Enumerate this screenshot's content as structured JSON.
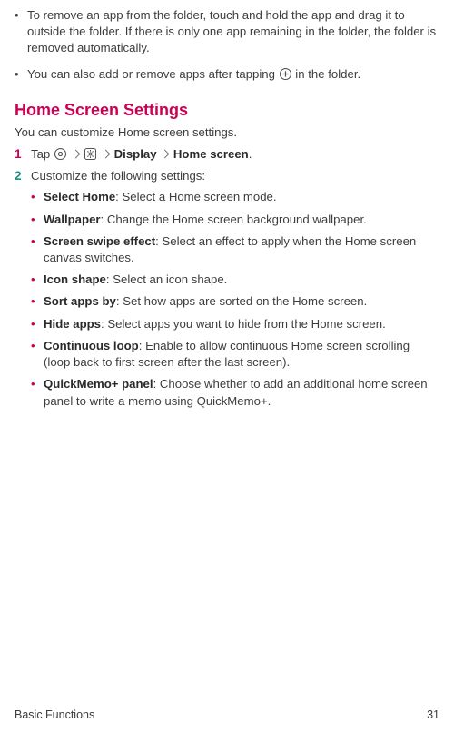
{
  "top_bullets": [
    "To remove an app from the folder, touch and hold the app and drag it to outside the folder. If there is only one app remaining in the folder, the folder is removed automatically.",
    {
      "prefix": "You can also add or remove apps after tapping ",
      "suffix": " in the folder."
    }
  ],
  "icons": {
    "plus_circle": "plus-circle-icon",
    "home_circle": "home-circle-icon",
    "settings_square": "settings-square-icon"
  },
  "section": {
    "title": "Home Screen Settings",
    "subtitle": "You can customize Home screen settings."
  },
  "steps": {
    "one": {
      "num": "1",
      "tap_label": "Tap ",
      "display_label": "Display",
      "home_screen_label": "Home screen",
      "period": "."
    },
    "two": {
      "num": "2",
      "text": "Customize the following settings:"
    }
  },
  "settings": [
    {
      "name": "Select Home",
      "desc": ": Select a Home screen mode."
    },
    {
      "name": "Wallpaper",
      "desc": ": Change the Home screen background wallpaper."
    },
    {
      "name": "Screen swipe effect",
      "desc": ": Select an effect to apply when the Home screen canvas switches."
    },
    {
      "name": "Icon shape",
      "desc": ": Select an icon shape."
    },
    {
      "name": "Sort apps by",
      "desc": ": Set how apps are sorted on the Home screen."
    },
    {
      "name": "Hide apps",
      "desc": ": Select apps you want to hide from the Home screen."
    },
    {
      "name": "Continuous loop",
      "desc": ": Enable to allow continuous Home screen scrolling (loop back to first screen after the last screen)."
    },
    {
      "name": "QuickMemo+ panel",
      "desc": ": Choose whether to add an additional home screen panel to write a memo using QuickMemo+."
    }
  ],
  "footer": {
    "left": "Basic Functions",
    "right": "31"
  }
}
